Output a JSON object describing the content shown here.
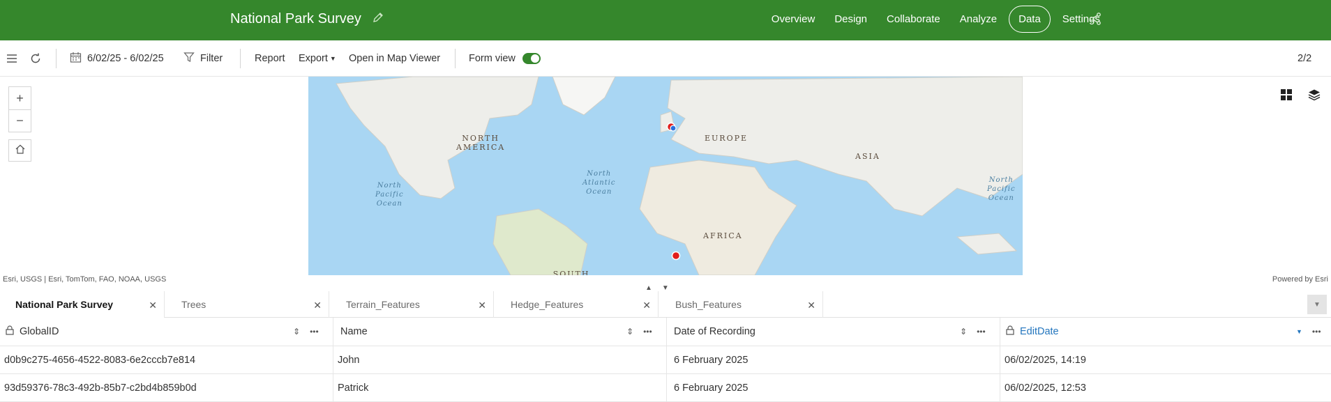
{
  "header": {
    "title": "National Park Survey",
    "nav": [
      {
        "label": "Overview"
      },
      {
        "label": "Design"
      },
      {
        "label": "Collaborate"
      },
      {
        "label": "Analyze"
      },
      {
        "label": "Data"
      },
      {
        "label": "Settings"
      }
    ],
    "active_nav": "Data"
  },
  "toolbar": {
    "date_range": "6/02/25 - 6/02/25",
    "filter_label": "Filter",
    "report_label": "Report",
    "export_label": "Export",
    "map_viewer_label": "Open in Map Viewer",
    "form_view_label": "Form view",
    "form_view_on": true,
    "record_count": "2/2"
  },
  "map": {
    "continents": {
      "north_america": "NORTH\nAMERICA",
      "europe": "EUROPE",
      "asia": "ASIA",
      "africa": "AFRICA",
      "south_america": "SOUTH\nAMERICA"
    },
    "oceans": {
      "north_pacific_west": "North\nPacific\nOcean",
      "north_atlantic": "North\nAtlantic\nOcean",
      "north_pacific_east": "North\nPacific\nOcean"
    },
    "attribution": "Esri, USGS | Esri, TomTom, FAO, NOAA, USGS",
    "powered_by": "Powered by Esri",
    "zoom_in": "+",
    "zoom_out": "−"
  },
  "tabs": [
    {
      "label": "National Park Survey",
      "active": true
    },
    {
      "label": "Trees"
    },
    {
      "label": "Terrain_Features"
    },
    {
      "label": "Hedge_Features"
    },
    {
      "label": "Bush_Features"
    }
  ],
  "table": {
    "columns": [
      "GlobalID",
      "Name",
      "Date of Recording",
      "EditDate"
    ],
    "rows": [
      [
        "d0b9c275-4656-4522-8083-6e2cccb7e814",
        "John",
        "6 February 2025",
        "06/02/2025, 14:19"
      ],
      [
        "93d59376-78c3-492b-85b7-c2bd4b859b0d",
        "Patrick",
        "6 February 2025",
        "06/02/2025, 12:53"
      ]
    ]
  },
  "colors": {
    "brand": "#35872c",
    "link": "#2476be",
    "marker_red": "#e01d1d",
    "marker_blue": "#2a6fdb"
  }
}
